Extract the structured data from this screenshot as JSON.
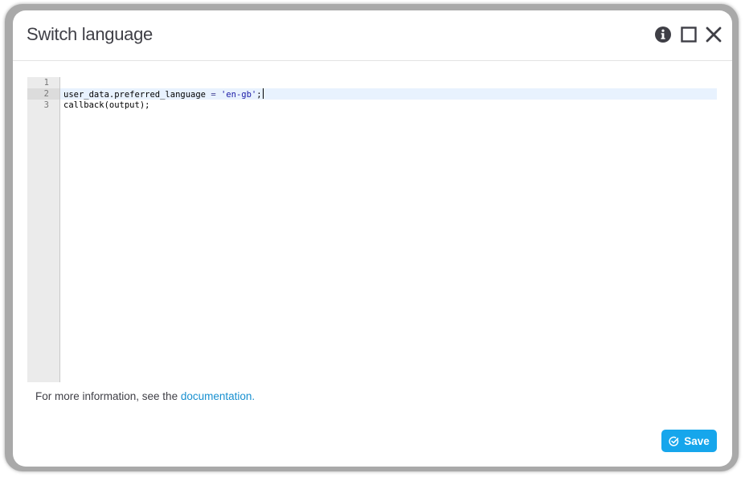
{
  "dialog": {
    "title": "Switch language",
    "buttons": {
      "info_icon": "info-circle-icon",
      "maximize_icon": "maximize-square-icon",
      "close_icon": "close-x-icon"
    }
  },
  "editor": {
    "line_numbers": [
      "1",
      "2",
      "3"
    ],
    "active_line": 2,
    "lines": [
      {
        "parts": []
      },
      {
        "parts": [
          {
            "text": "user_data.preferred_language ",
            "kind": "plain"
          },
          {
            "text": "=",
            "kind": "op"
          },
          {
            "text": " ",
            "kind": "plain"
          },
          {
            "text": "'en-gb'",
            "kind": "str"
          },
          {
            "text": ";",
            "kind": "plain"
          }
        ]
      },
      {
        "parts": [
          {
            "text": "callback(output);",
            "kind": "plain"
          }
        ]
      }
    ]
  },
  "footer": {
    "info_prefix": "For more information, see the ",
    "info_link": "documentation",
    "info_suffix": ".",
    "save_label": "Save",
    "save_icon": "check-circle-icon"
  },
  "colors": {
    "accent": "#16a6ec",
    "link": "#1890d0",
    "active_line": "#e8f2fe",
    "gutter": "#ebebeb"
  }
}
